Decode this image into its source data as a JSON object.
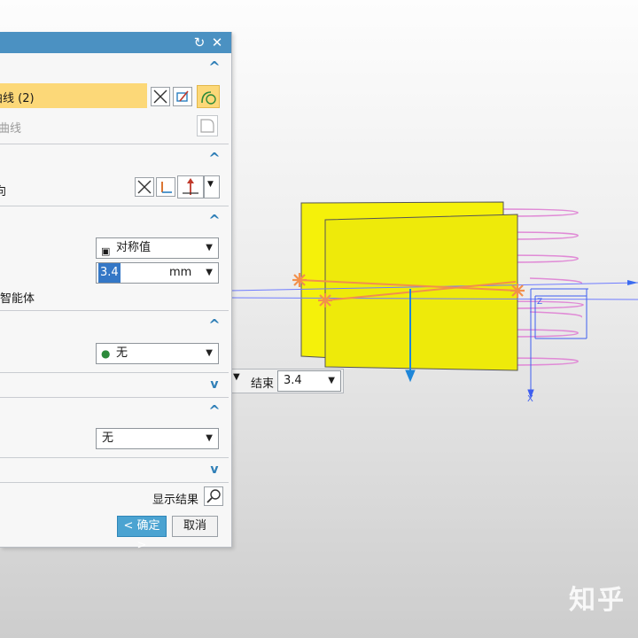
{
  "dialog": {
    "section1": {
      "selection_label": "曲线 (2)",
      "select_entry_label": "曲线"
    },
    "section2": {
      "label": "向"
    },
    "section3": {
      "end_option": "对称值",
      "distance_value": "3.4",
      "distance_unit": "mm",
      "checkbox_label": "开放智能体"
    },
    "section4": {
      "option": "无"
    },
    "section6": {
      "option": "无"
    },
    "show_result_label": "显示结果",
    "ok_label": "< 确定 >",
    "cancel_label": "取消"
  },
  "float_toolbar": {
    "end_label": "结束",
    "end_value": "3.4"
  },
  "axis_labels": {
    "x": "X",
    "z": "Z"
  },
  "watermark": "知乎",
  "colors": {
    "title_bar": "#4b91c2",
    "highlight": "#fcd878",
    "surface": "#f5f10a",
    "ok_button": "#4ba3d1"
  }
}
